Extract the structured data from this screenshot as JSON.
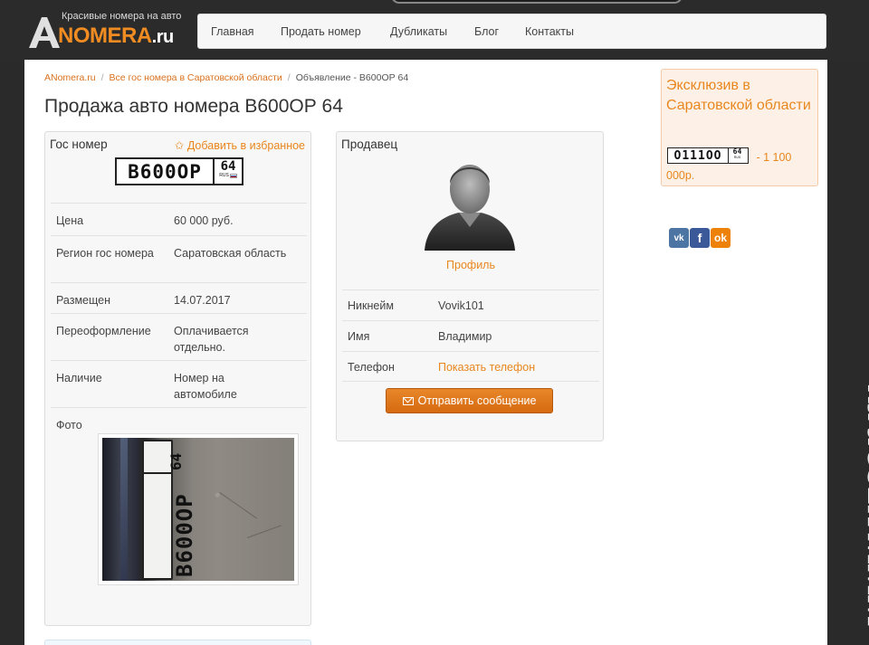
{
  "header": {
    "logo_tagline": "Красивые номера на авто",
    "logo_main": "NOMERA",
    "logo_suffix": ".ru",
    "nav": [
      "Главная",
      "Продать номер",
      "Дубликаты",
      "Блог",
      "Контакты"
    ]
  },
  "breadcrumb": [
    "ANomera.ru",
    "Все гос номера в Саратовской области",
    "Объявление - В600ОР 64"
  ],
  "page_title": "Продажа авто номера В600ОР 64",
  "plate_panel": {
    "title": "Гос номер",
    "favorite": "✩ Добавить в избранное",
    "plate": {
      "number": "В600ОР",
      "region": "64",
      "country": "RUS"
    },
    "rows": [
      {
        "key": "Цена",
        "value": "60 000 руб."
      },
      {
        "key": "Регион гос номера",
        "value": "Саратовская область"
      },
      {
        "key": "Размещен",
        "value": "14.07.2017"
      },
      {
        "key": "Переоформление",
        "value": "Оплачивается отдельно."
      },
      {
        "key": "Наличие",
        "value": "Номер на автомобиле"
      },
      {
        "key": "Фото",
        "value": ""
      }
    ]
  },
  "seller_panel": {
    "title": "Продавец",
    "profile_link": "Профиль",
    "rows": [
      {
        "key": "Никнейм",
        "value": "Vovik101"
      },
      {
        "key": "Имя",
        "value": "Владимир"
      },
      {
        "key": "Телефон",
        "value": "Показать телефон"
      }
    ],
    "message_button": "Отправить сообщение"
  },
  "exclusive": {
    "title": "Эксклюзив в Саратовской области",
    "plate": {
      "number": "О111ОО",
      "region": "64",
      "country": "RUS"
    },
    "price": " - 1 100 000р."
  },
  "social": [
    "vk",
    "f",
    "ok"
  ],
  "watermark": "www.vzsar.ru",
  "colors": {
    "accent": "#e8871e",
    "button": "#d66a10",
    "header_bg": "#2b2b2b"
  }
}
